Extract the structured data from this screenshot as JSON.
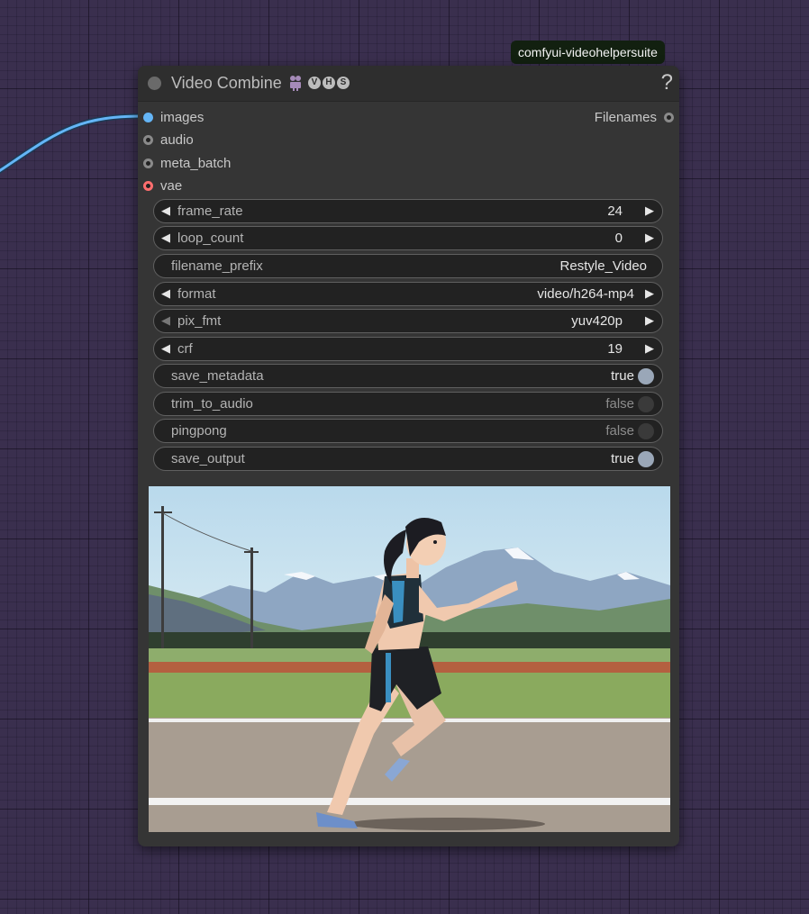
{
  "source_badge": "comfyui-videohelpersuite",
  "node": {
    "title": "Video Combine",
    "title_icon": "film-icon",
    "vhs_letters": [
      "V",
      "H",
      "S"
    ],
    "help_icon": "?",
    "inputs": [
      {
        "label": "images",
        "color": "#64b5f6"
      },
      {
        "label": "audio",
        "color": "#8a8a8a"
      },
      {
        "label": "meta_batch",
        "color": "#8a8a8a"
      },
      {
        "label": "vae",
        "color": "#ff6e6e"
      }
    ],
    "output": {
      "label": "Filenames",
      "color": "#8a8a8a"
    }
  },
  "widgets": {
    "frame_rate": {
      "label": "frame_rate",
      "value": "24"
    },
    "loop_count": {
      "label": "loop_count",
      "value": "0"
    },
    "filename_prefix": {
      "label": "filename_prefix",
      "value": "Restyle_Video"
    },
    "format": {
      "label": "format",
      "value": "video/h264-mp4"
    },
    "pix_fmt": {
      "label": "pix_fmt",
      "value": "yuv420p"
    },
    "crf": {
      "label": "crf",
      "value": "19"
    },
    "save_metadata": {
      "label": "save_metadata",
      "value": "true"
    },
    "trim_to_audio": {
      "label": "trim_to_audio",
      "value": "false"
    },
    "pingpong": {
      "label": "pingpong",
      "value": "false"
    },
    "save_output": {
      "label": "save_output",
      "value": "true"
    }
  },
  "arrows": {
    "left": "◀",
    "right": "▶"
  },
  "colors": {
    "canvas_bg": "#3a2f4e",
    "node_bg": "#353535",
    "widget_bg": "#222222",
    "link_color": "#64b5f6",
    "toggle_on": "#9aa7b8"
  },
  "preview": {
    "subject": "illustrated woman running on a track with snowy mountains behind"
  }
}
